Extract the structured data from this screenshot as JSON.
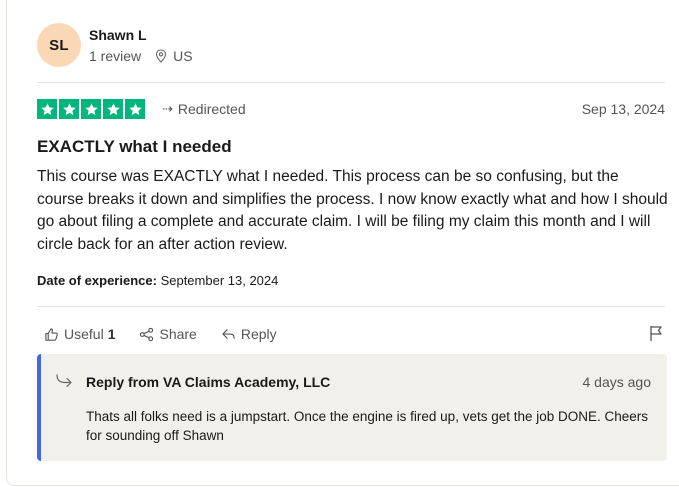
{
  "reviewer": {
    "initials": "SL",
    "name": "Shawn L",
    "review_count": "1 review",
    "country": "US",
    "avatar_color": "#fad7b5"
  },
  "rating": {
    "stars": 5,
    "max_stars": 5,
    "star_color": "#00b67a",
    "source_label": "Redirected",
    "date": "Sep 13, 2024"
  },
  "review": {
    "title": "EXACTLY what I needed",
    "body": "This course was EXACTLY what I needed. This process can be so confusing, but the course breaks it down and simplifies the process. I now know exactly what and how I should go about filing a complete and accurate claim. I will be filing my claim this month and I will circle back for an after action review.",
    "experience_label": "Date of experience:",
    "experience_date": "September 13, 2024"
  },
  "actions": {
    "useful_label": "Useful",
    "useful_count": "1",
    "share_label": "Share",
    "reply_label": "Reply",
    "flag_icon": "flag-icon"
  },
  "reply": {
    "from": "Reply from VA Claims Academy, LLC",
    "date": "4 days ago",
    "text": "Thats all folks need is a jumpstart. Once the engine is fired up, vets get the job DONE. Cheers for sounding off Shawn",
    "accent_color": "#3f69ea"
  }
}
